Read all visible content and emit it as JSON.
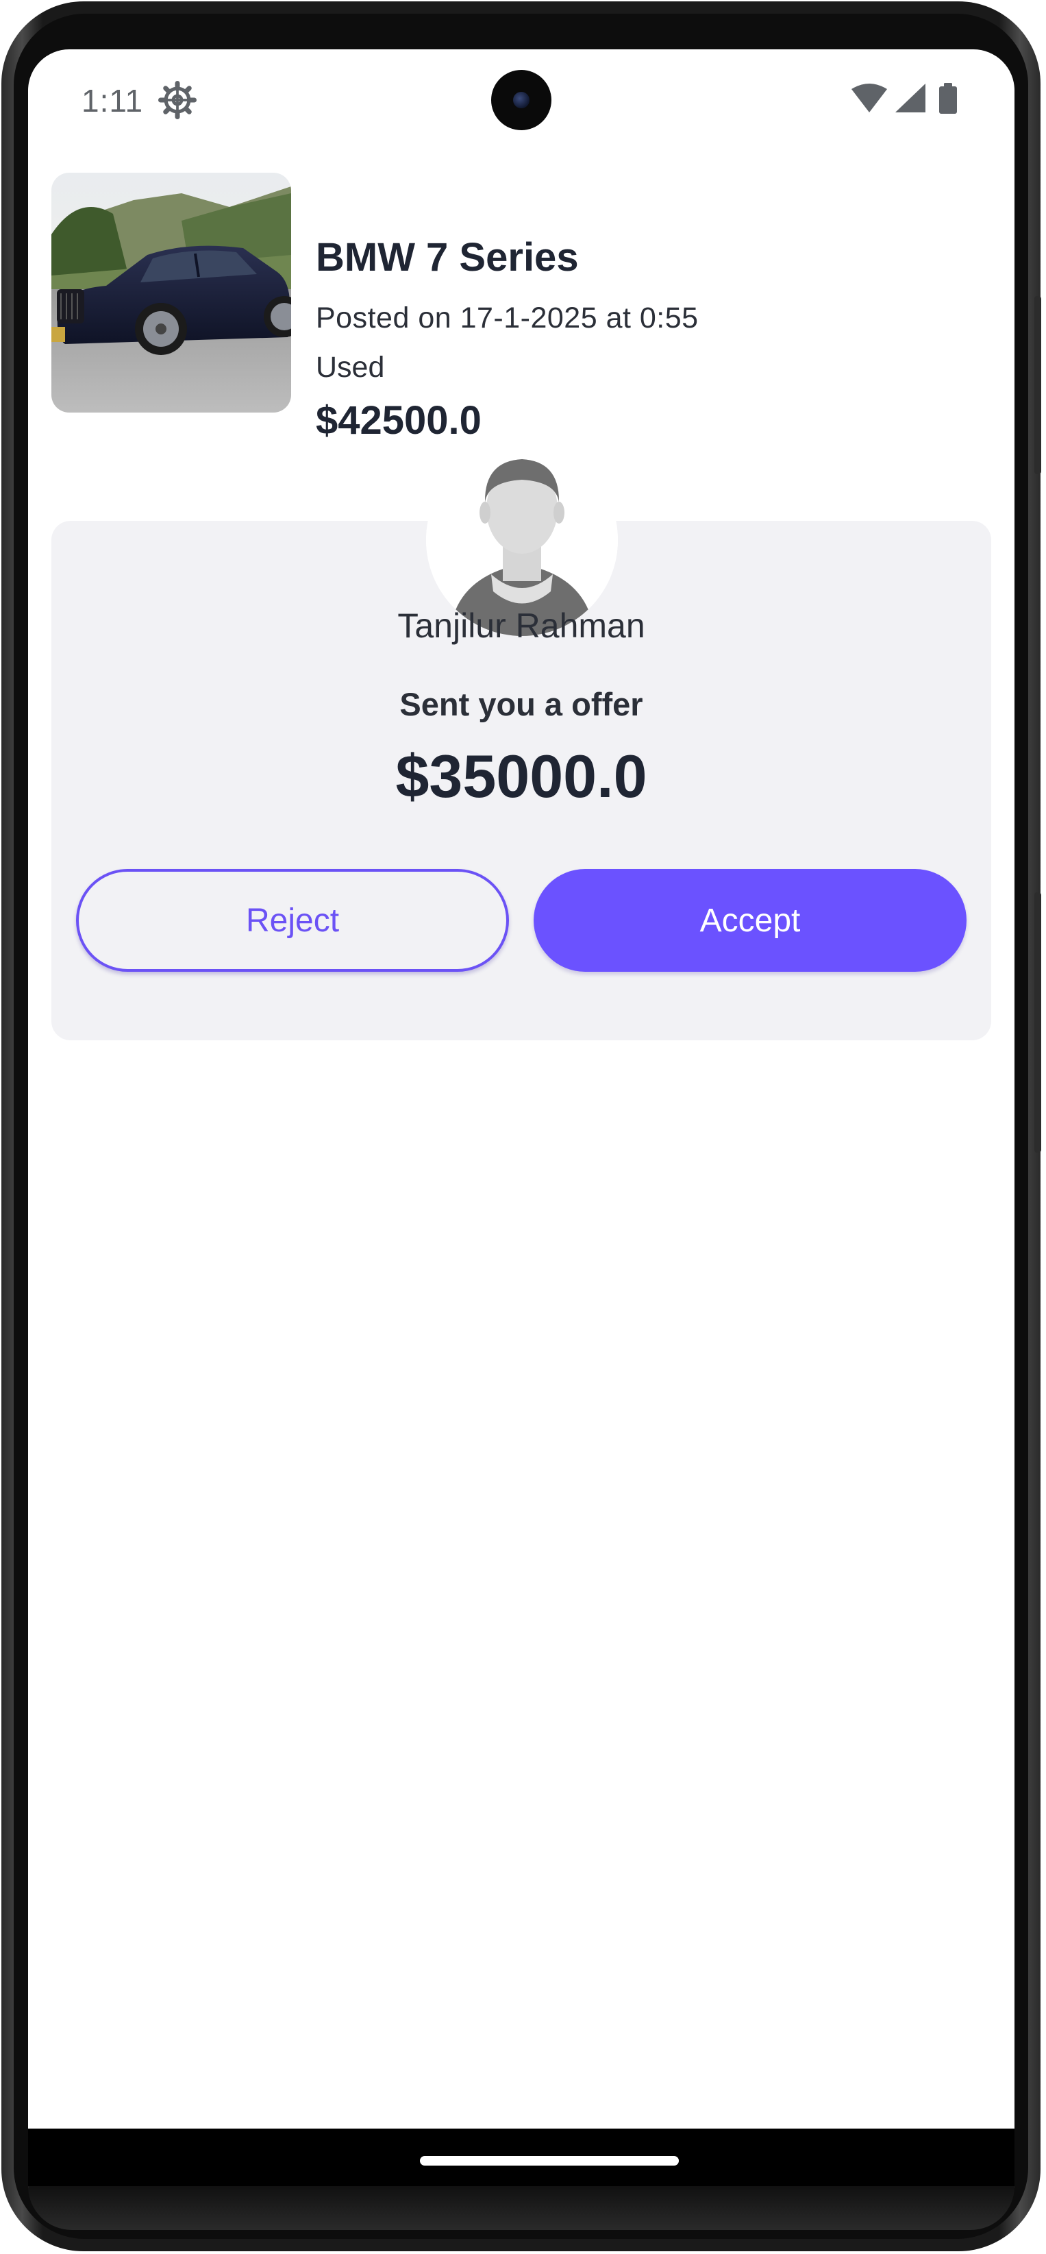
{
  "status_bar": {
    "time": "1:11",
    "icons": [
      "gear-icon",
      "wifi-icon",
      "cellular-signal-icon",
      "battery-icon"
    ]
  },
  "listing": {
    "title": "BMW 7 Series",
    "posted": "Posted on 17-1-2025 at 0:55",
    "condition": "Used",
    "price": "$42500.0"
  },
  "offer": {
    "sender_name": "Tanjilur Rahman",
    "message": "Sent you a offer",
    "amount": "$35000.0",
    "reject_label": "Reject",
    "accept_label": "Accept"
  },
  "colors": {
    "accent": "#6b52ff",
    "card_background": "#f2f2f5",
    "text_dark": "#1f2533"
  }
}
